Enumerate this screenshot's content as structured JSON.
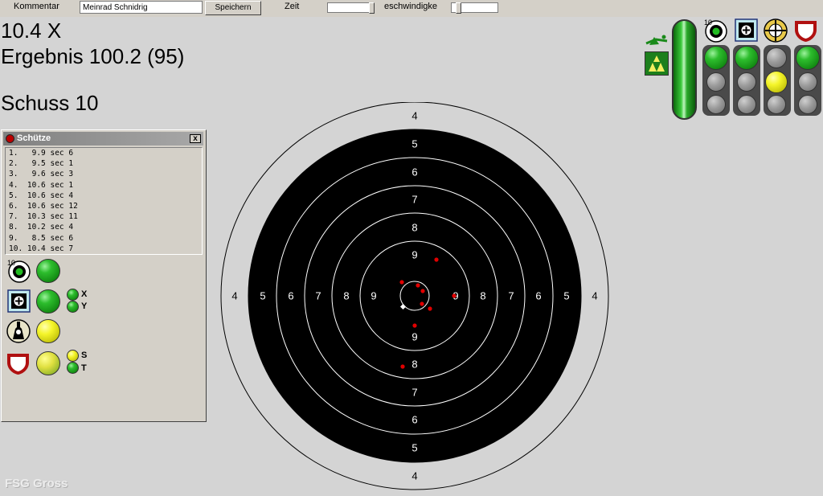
{
  "toolbar": {
    "kommentar_label": "Kommentar",
    "kommentar_value": "Meinrad Schnidrig",
    "save_label": "Speichern",
    "zeit_label": "Zeit",
    "geschw_label": "eschwindigke"
  },
  "result": {
    "last_shot": "10.4 X",
    "total": "Ergebnis 100.2 (95)",
    "shot_count": "Schuss 10"
  },
  "panel": {
    "title": "Schütze",
    "close_glyph": "x",
    "shots": [
      "1.   9.9 sec 6",
      "2.   9.5 sec 1",
      "3.   9.6 sec 3",
      "4.  10.6 sec 1",
      "5.  10.6 sec 4",
      "6.  10.6 sec 12",
      "7.  10.3 sec 11",
      "8.  10.2 sec 4",
      "9.   8.5 sec 6",
      "10. 10.4 sec 7"
    ],
    "icon_ten_label": "10",
    "axis_x": "X",
    "axis_y": "Y",
    "sensor_s": "S",
    "sensor_t": "T"
  },
  "status_icons": {
    "ten_label": "10"
  },
  "target": {
    "ring_labels": {
      "top": [
        "4",
        "5",
        "6",
        "7",
        "8",
        "9"
      ],
      "bottom": [
        "9",
        "8",
        "7",
        "6",
        "5",
        "4"
      ],
      "left": [
        "4",
        "5",
        "6",
        "7",
        "8",
        "9"
      ],
      "right": [
        "9",
        "8",
        "7",
        "6",
        "5",
        "4"
      ]
    }
  },
  "watermark": "FSG Gross",
  "colors": {
    "background": "#d4d4d4",
    "target_black": "#000000",
    "hit": "#e00000",
    "last_hit": "#ffffff",
    "lamp_green": "#2dbd2d",
    "lamp_yellow": "#f5f52a",
    "lamp_off": "#9a9a9a"
  }
}
